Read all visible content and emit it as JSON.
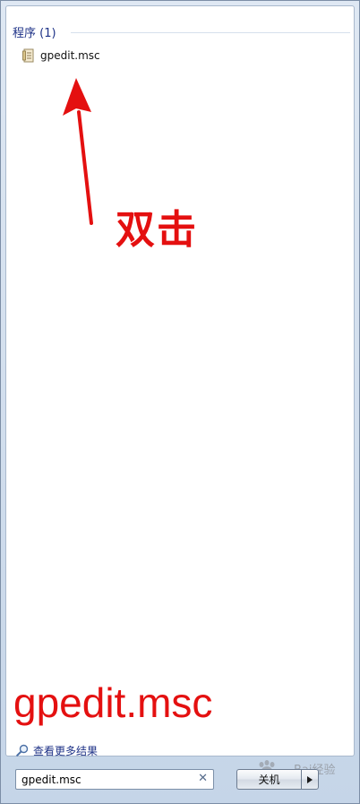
{
  "results": {
    "section_header": "程序 (1)",
    "items": [
      {
        "label": "gpedit.msc",
        "icon": "msc-file-icon"
      }
    ]
  },
  "annotations": {
    "double_click": "双击",
    "command": "gpedit.msc",
    "color": "#e41010"
  },
  "see_more": {
    "label": "查看更多结果",
    "icon": "search-icon"
  },
  "search": {
    "value": "gpedit.msc",
    "clear_icon": "close-icon"
  },
  "shutdown": {
    "label": "关机",
    "arrow_icon": "triangle-right-icon"
  },
  "watermark": {
    "text": "Bai经验"
  }
}
